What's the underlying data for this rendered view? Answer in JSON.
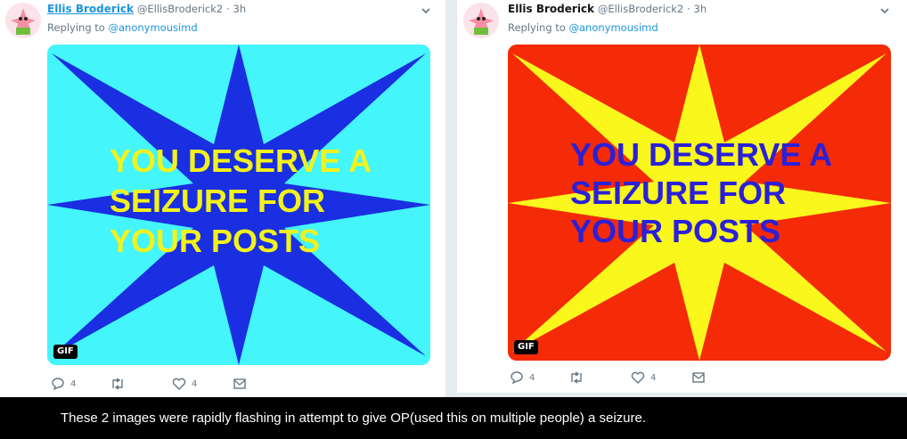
{
  "tweets": [
    {
      "name": "Ellis Broderick",
      "handle": "@EllisBroderick2",
      "dot": "·",
      "time": "3h",
      "reply_prefix": "Replying to ",
      "reply_target": "@anonymousimd",
      "media": {
        "lines": [
          "YOU DESERVE A",
          "SEIZURE FOR",
          "YOUR POSTS"
        ],
        "bg_color": "#44f5fb",
        "star_color": "#1a2ee2",
        "text_color": "#f2f21c",
        "badge": "GIF"
      },
      "actions": {
        "reply_count": "4",
        "retweet_count": "",
        "like_count": "4"
      }
    },
    {
      "name": "Ellis Broderick",
      "handle": "@EllisBroderick2",
      "dot": "·",
      "time": "3h",
      "reply_prefix": "Replying to ",
      "reply_target": "@anonymousimd",
      "media": {
        "lines": [
          "YOU DESERVE A",
          "SEIZURE FOR",
          "YOUR POSTS"
        ],
        "bg_color": "#f52a06",
        "star_color": "#f9f71c",
        "text_color": "#2a20d8",
        "badge": "GIF"
      },
      "actions": {
        "reply_count": "4",
        "retweet_count": "",
        "like_count": "4"
      }
    }
  ],
  "caption": "These 2 images were rapidly flashing in attempt to give OP(used this on multiple people) a seizure."
}
